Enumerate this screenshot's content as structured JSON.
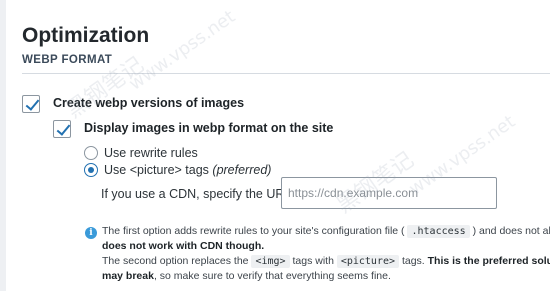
{
  "page": {
    "title": "Optimization",
    "section": "WEBP FORMAT"
  },
  "options": {
    "create_webp": {
      "label": "Create webp versions of images",
      "checked": true
    },
    "display_webp": {
      "label": "Display images in webp format on the site",
      "checked": true
    },
    "rewrite": {
      "label": "Use rewrite rules",
      "selected": false
    },
    "picture": {
      "label_prefix": "Use <picture> tags ",
      "label_suffix": "(preferred)",
      "selected": true
    }
  },
  "cdn": {
    "label": "If you use a CDN, specify the URL:",
    "placeholder": "https://cdn.example.com",
    "value": ""
  },
  "note": {
    "line1_a": "The first option adds rewrite rules to your site's configuration file (",
    "line1_code": ".htaccess",
    "line1_b": ") and does not alter yo",
    "line2_bold": "does not work with CDN though.",
    "line3_a": "The second option replaces the",
    "line3_code1": "<img>",
    "line3_b": "tags with",
    "line3_code2": "<picture>",
    "line3_c": "tags.",
    "line3_bold": "This is the preferred solution",
    "line4_bold": "may break",
    "line4_rest": ", so make sure to verify that everything seems fine."
  },
  "watermarks": [
    "黑钢笔记",
    "www.vpss.net"
  ],
  "colors": {
    "accent": "#2271b1",
    "info": "#3a9ad9"
  }
}
